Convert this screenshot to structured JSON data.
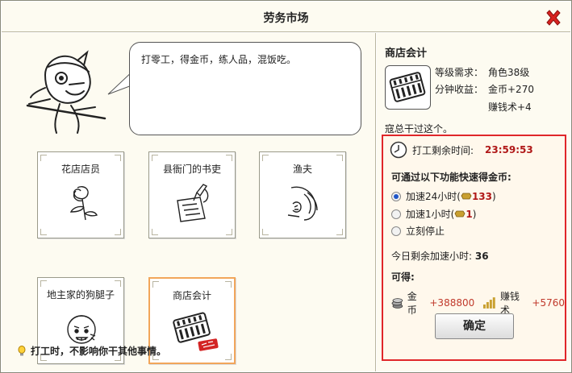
{
  "window": {
    "title": "劳务市场",
    "close_icon": "close-x-icon"
  },
  "bubble": {
    "text": "打零工，得金币，练人品，混饭吃。"
  },
  "jobs": [
    {
      "label": "花店店员",
      "icon": "rose-icon",
      "selected": false
    },
    {
      "label": "县衙门的书吏",
      "icon": "brush-scroll-icon",
      "selected": false
    },
    {
      "label": "渔夫",
      "icon": "fishing-icon",
      "selected": false
    },
    {
      "label": "地主家的狗腿子",
      "icon": "thug-face-icon",
      "selected": false
    },
    {
      "label": "商店会计",
      "icon": "abacus-icon",
      "selected": true
    }
  ],
  "tip": {
    "text": "打工时，不影响你干其他事情。",
    "icon": "bulb-icon"
  },
  "detail": {
    "title": "商店会计",
    "level_label": "等级需求：",
    "level_value": "角色38级",
    "income_label": "分钟收益：",
    "income_value_1": "金币+270",
    "income_value_2": "赚钱术+4",
    "done_text": "寇总干过这个。"
  },
  "panel": {
    "timer_label": "打工剩余时间:",
    "timer_value": "23:59:53",
    "speed_title": "可通过以下功能快速得金币:",
    "options": [
      {
        "prefix": "加速24小时(",
        "cost": "133",
        "suffix": ")",
        "checked": true
      },
      {
        "prefix": "加速1小时(",
        "cost": "1",
        "suffix": ")",
        "checked": false
      },
      {
        "prefix": "立刻停止",
        "cost": "",
        "suffix": "",
        "checked": false
      }
    ],
    "hours_label": "今日剩余加速小时:",
    "hours_value": "36",
    "gain_title": "可得:",
    "gold_label": "金币",
    "gold_value": "+388800",
    "skill_label": "赚钱术",
    "skill_value": "+5760",
    "confirm_label": "确定"
  },
  "colors": {
    "accent_red": "#e0262a",
    "value_red": "#b01818",
    "radio_blue": "#1e56c8",
    "selected_border": "#f2a65a"
  }
}
